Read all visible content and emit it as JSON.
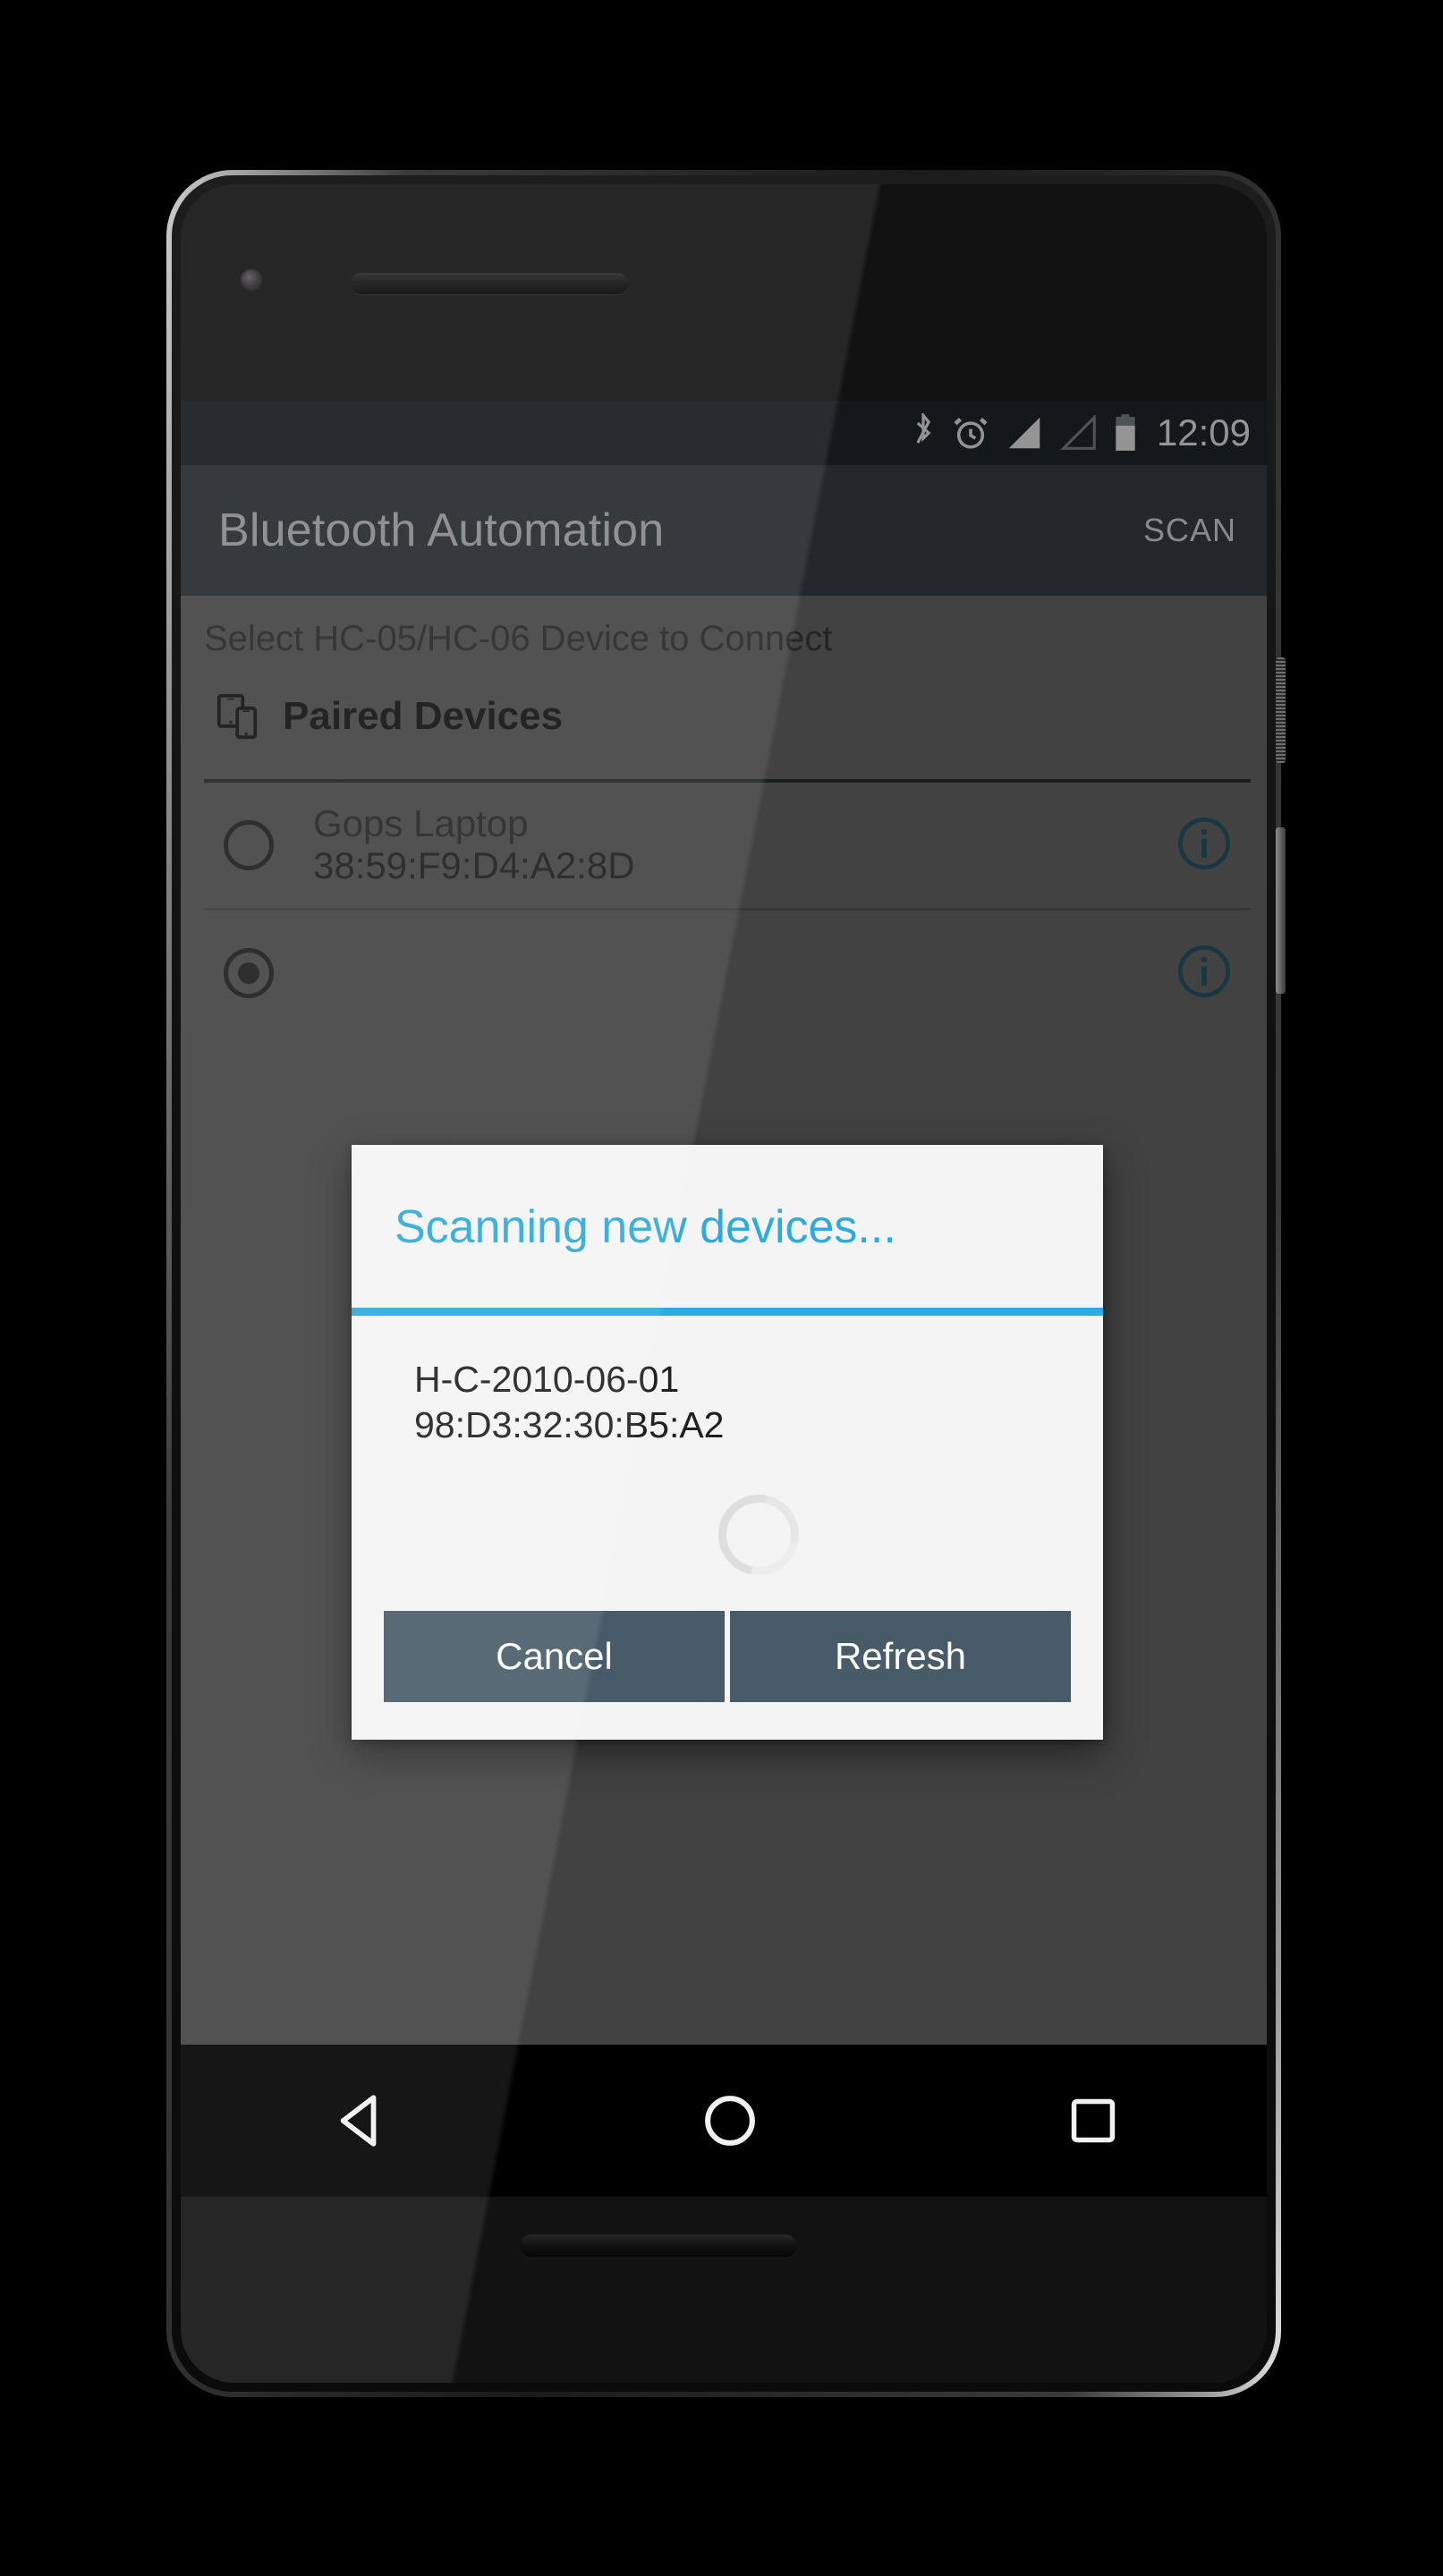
{
  "status_bar": {
    "clock": "12:09",
    "icons": [
      "bluetooth-icon",
      "alarm-icon",
      "signal-full-icon",
      "signal-empty-icon",
      "battery-icon"
    ]
  },
  "app_bar": {
    "title": "Bluetooth Automation",
    "action_label": "SCAN"
  },
  "content": {
    "hint": "Select HC-05/HC-06 Device to Connect",
    "section_title": "Paired Devices",
    "section_icon": "devices-icon",
    "devices": [
      {
        "name": "Gops Laptop",
        "mac": "38:59:F9:D4:A2:8D",
        "selected": false,
        "info_icon": "info-icon"
      },
      {
        "name": "",
        "mac": "",
        "selected": true,
        "info_icon": "info-icon"
      }
    ]
  },
  "dialog": {
    "title": "Scanning new devices...",
    "device_name": "H-C-2010-06-01",
    "device_mac": "98:D3:32:30:B5:A2",
    "spinner": "loading-spinner",
    "cancel_label": "Cancel",
    "refresh_label": "Refresh"
  },
  "nav_bar": {
    "back": "back-icon",
    "home": "home-icon",
    "recents": "recents-icon"
  },
  "colors": {
    "accent": "#2eaadc",
    "app_bar": "#3b444a",
    "status_bar": "#222a2e",
    "dialog_button": "#475c68",
    "content_bg": "#727272"
  }
}
